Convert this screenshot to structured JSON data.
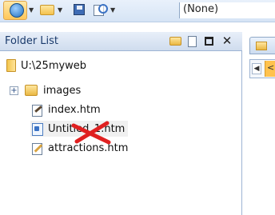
{
  "toolbar": {
    "style_value": "(None)",
    "icons": [
      "circle-icon",
      "folder-open-icon",
      "save-icon",
      "search-doc-icon"
    ]
  },
  "folder_list": {
    "title": "Folder List",
    "root": "U:\\25myweb",
    "items": [
      {
        "label": "images",
        "type": "folder",
        "expandable": true
      },
      {
        "label": "index.htm",
        "type": "home-page"
      },
      {
        "label": "Untitled_1.htm",
        "type": "page",
        "selected": true,
        "marked_with_red_x": true
      },
      {
        "label": "attractions.htm",
        "type": "page-edit"
      }
    ]
  },
  "colors": {
    "pane_header": "#cfdcee",
    "title_text": "#1a3a6b",
    "selected_row": "#f0f0f0",
    "red_x": "#e02020",
    "orange_accent": "#ffc24d"
  }
}
